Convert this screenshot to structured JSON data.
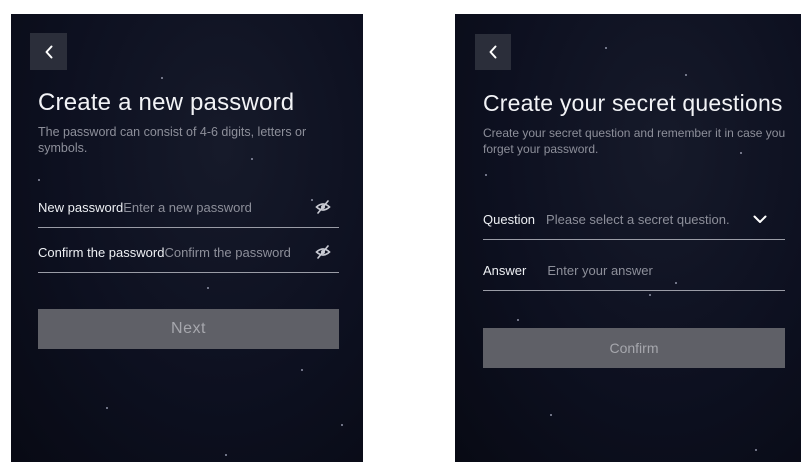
{
  "left": {
    "back_icon": "chevron-left-icon",
    "title": "Create a new password",
    "subtitle": "The password can consist of 4-6 digits, letters or symbols.",
    "new_password": {
      "label": "New password",
      "placeholder": "Enter a new password",
      "icon": "eye-off-icon"
    },
    "confirm_password": {
      "label": "Confirm the password",
      "placeholder": "Confirm the password",
      "icon": "eye-off-icon"
    },
    "next_label": "Next"
  },
  "right": {
    "back_icon": "chevron-left-icon",
    "title": "Create your secret questions",
    "subtitle": "Create your secret question and remember it in case you forget your password.",
    "question": {
      "label": "Question",
      "value": "Please select a secret question.",
      "icon": "chevron-down-icon"
    },
    "answer": {
      "label": "Answer",
      "placeholder": "Enter your answer"
    },
    "confirm_label": "Confirm"
  },
  "colors": {
    "background": "#0d1020",
    "button_disabled": "#5f6067",
    "text_primary": "#f2f3f6",
    "text_secondary": "#8d8f9a"
  }
}
